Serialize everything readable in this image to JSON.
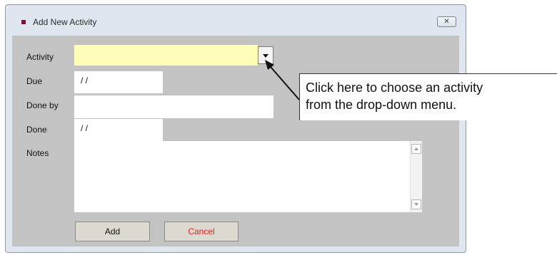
{
  "window": {
    "title": "Add New Activity",
    "close_glyph": "✕"
  },
  "form": {
    "activity": {
      "label": "Activity",
      "value": ""
    },
    "due": {
      "label": "Due",
      "value": "/ /"
    },
    "done_by": {
      "label": "Done by",
      "value": ""
    },
    "done": {
      "label": "Done",
      "value": "/ /"
    },
    "notes": {
      "label": "Notes",
      "value": ""
    }
  },
  "buttons": {
    "add": "Add",
    "cancel": "Cancel"
  },
  "callout": {
    "line1": "Click here to choose an activity",
    "line2": "from the drop-down menu."
  },
  "colors": {
    "activity_field_bg": "#fefeb8",
    "cancel_text": "#e81b1b",
    "dialog_bg": "#c3c3c3"
  },
  "icons": {
    "title": "square-bullet-icon",
    "close": "close-icon",
    "dropdown": "chevron-down-icon"
  }
}
